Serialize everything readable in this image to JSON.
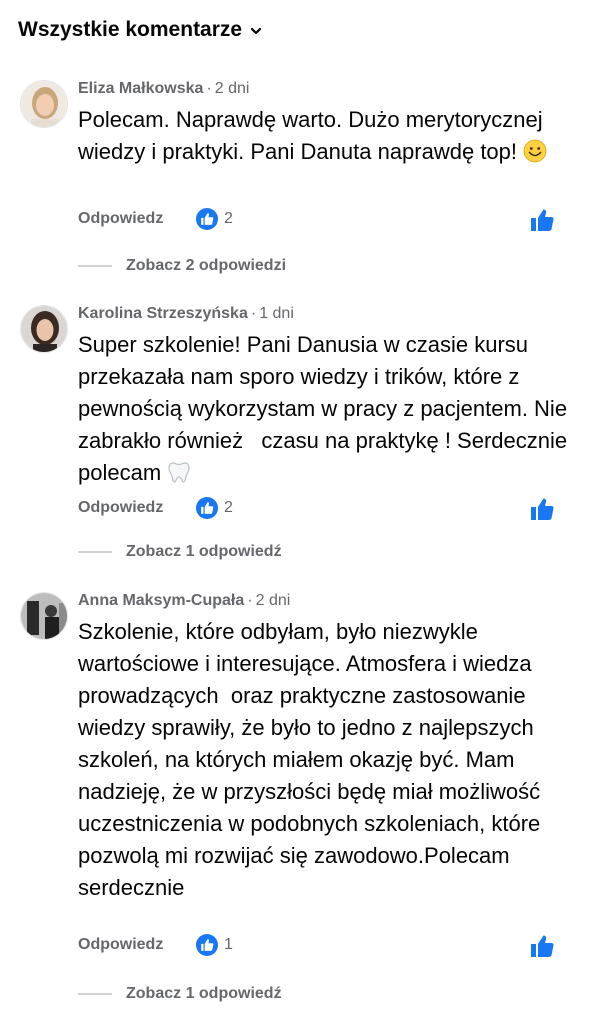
{
  "header": {
    "title": "Wszystkie komentarze"
  },
  "comments": [
    {
      "author": "Eliza Małkowska",
      "time": "2 dni",
      "text": "Polecam. Naprawdę warto. Dużo merytorycznej wiedzy i praktyki. Pani Danuta naprawdę top!",
      "trailing_emoji": "smiling-face-icon",
      "reply_label": "Odpowiedz",
      "reaction_count": "2",
      "replies_label": "Zobacz 2 odpowiedzi"
    },
    {
      "author": "Karolina Strzeszyńska",
      "time": "1 dni",
      "text": "Super szkolenie! Pani Danusia w czasie kursu przekazała nam sporo wiedzy i trików, które z pewnością wykorzystam w pracy z pacjentem. Nie zabrakło również   czasu na praktykę ! Serdecznie polecam",
      "trailing_emoji": "tooth-icon",
      "reply_label": "Odpowiedz",
      "reaction_count": "2",
      "replies_label": "Zobacz 1 odpowiedź"
    },
    {
      "author": "Anna Maksym-Cupała",
      "time": "2 dni",
      "text": "Szkolenie, które odbyłam, było niezwykle wartościowe i interesujące. Atmosfera i wiedza prowadzących  oraz praktyczne zastosowanie wiedzy sprawiły, że było to jedno z najlepszych szkoleń, na których miałem okazję być. Mam nadzieję, że w przyszłości będę miał możliwość uczestniczenia w podobnych szkoleniach, które pozwolą mi rozwijać się zawodowo.Polecam serdecznie",
      "trailing_emoji": "",
      "reply_label": "Odpowiedz",
      "reaction_count": "1",
      "replies_label": "Zobacz 1 odpowiedź"
    }
  ],
  "colors": {
    "accent": "#1877f2",
    "secondary_text": "#65676b",
    "primary_text": "#050505"
  }
}
